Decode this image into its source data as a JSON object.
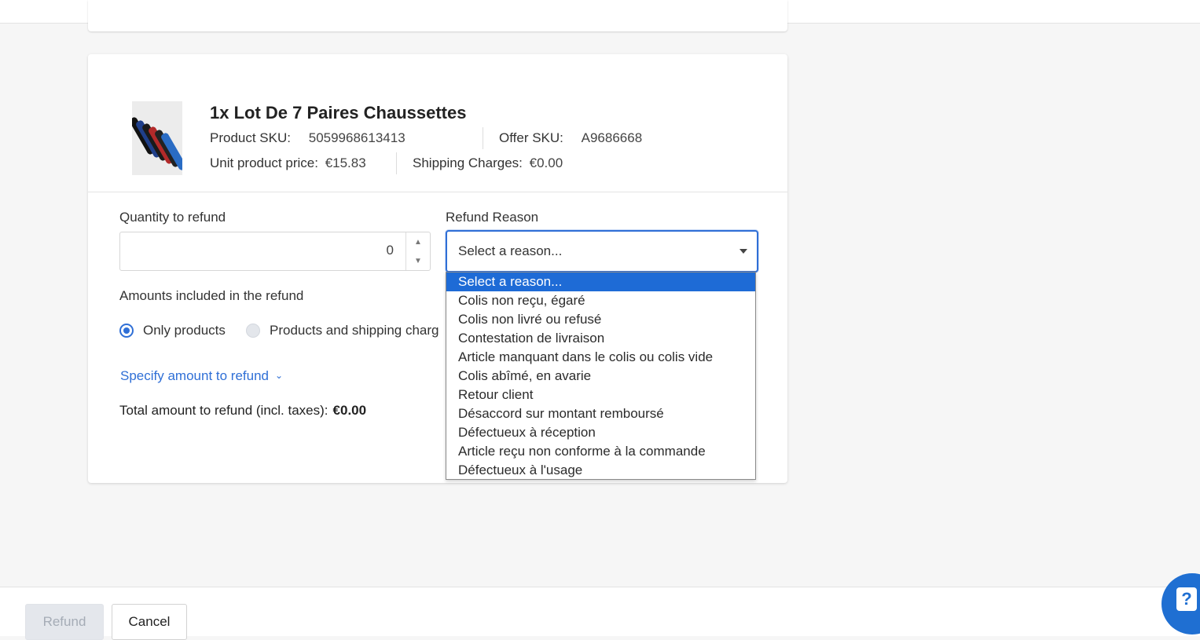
{
  "product": {
    "title": "1x Lot De 7 Paires Chaussettes",
    "sku_label": "Product SKU:",
    "sku_value": "5059968613413",
    "offer_sku_label": "Offer SKU:",
    "offer_sku_value": "A9686668",
    "unit_price_label": "Unit product price:",
    "unit_price_value": "€15.83",
    "shipping_label": "Shipping Charges:",
    "shipping_value": "€0.00"
  },
  "refund_form": {
    "quantity_label": "Quantity to refund",
    "quantity_value": "0",
    "reason_label": "Refund Reason",
    "reason_selected": "Select a reason...",
    "amounts_label": "Amounts included in the refund",
    "radio_only_products": "Only products",
    "radio_products_shipping": "Products and shipping charg",
    "radio_selected": "Only products",
    "specify_link": "Specify amount to refund",
    "total_label": "Total amount to refund (incl. taxes):",
    "total_value": "€0.00"
  },
  "reason_options": [
    "Select a reason...",
    "Colis non reçu, égaré",
    "Colis non livré ou refusé",
    "Contestation de livraison",
    "Article manquant dans le colis ou colis vide",
    "Colis abîmé, en avarie",
    "Retour client",
    "Désaccord sur montant remboursé",
    "Défectueux à réception",
    "Article reçu non conforme à la commande",
    "Défectueux à l'usage"
  ],
  "footer": {
    "refund_button": "Refund",
    "cancel_button": "Cancel"
  },
  "help": {
    "icon": "help-question-icon",
    "glyph": "?"
  },
  "colors": {
    "accent": "#2f6fd6",
    "selected_option_bg": "#1e6bd6",
    "background": "#f6f6f6"
  }
}
